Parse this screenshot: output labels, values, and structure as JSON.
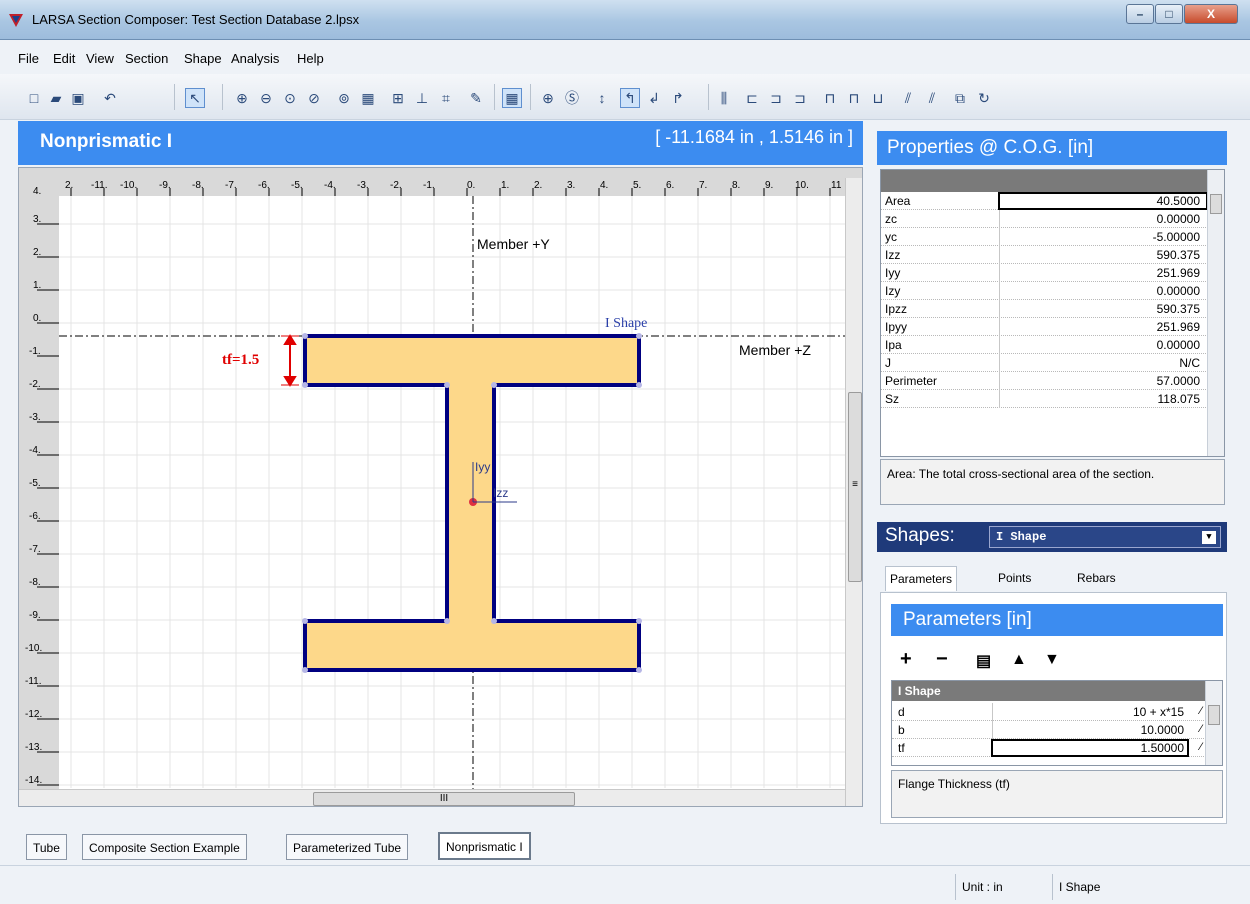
{
  "window": {
    "title": "LARSA Section Composer: Test Section Database 2.lpsx",
    "controls": [
      "–",
      "□",
      "X"
    ]
  },
  "menu": [
    "File",
    "Edit",
    "View",
    "Section",
    "Shape",
    "Analysis",
    "Help"
  ],
  "canvas": {
    "title": "Nonprismatic I",
    "cursor_coord": "[ -11.1684 in , 1.5146 in ]",
    "ruler_x": [
      "2.",
      "-11.",
      "-10.",
      "-9.",
      "-8.",
      "-7.",
      "-6.",
      "-5.",
      "-4.",
      "-3.",
      "-2.",
      "-1.",
      "0.",
      "1.",
      "2.",
      "3.",
      "4.",
      "5.",
      "6.",
      "7.",
      "8.",
      "9.",
      "10.",
      "11"
    ],
    "ruler_y": [
      "4.",
      "3.",
      "2.",
      "1.",
      "0.",
      "-1.",
      "-2.",
      "-3.",
      "-4.",
      "-5.",
      "-6.",
      "-7.",
      "-8.",
      "-9.",
      "-10.",
      "-11.",
      "-12.",
      "-13.",
      "-14."
    ],
    "axis_y_label": "Member +Y",
    "axis_z_label": "Member +Z",
    "shape_label": "I Shape",
    "dim_label": "tf=1.5",
    "iyy_label": "Iyy",
    "izz_label": "Izz",
    "hscroll_mark": "III",
    "vscroll_mark": "≡"
  },
  "properties": {
    "title": "Properties @ C.O.G. [in]",
    "rows": [
      {
        "name": "Area",
        "value": "40.5000"
      },
      {
        "name": "zc",
        "value": "0.00000"
      },
      {
        "name": "yc",
        "value": "-5.00000"
      },
      {
        "name": "Izz",
        "value": "590.375"
      },
      {
        "name": "Iyy",
        "value": "251.969"
      },
      {
        "name": "Izy",
        "value": "0.00000"
      },
      {
        "name": "Ipzz",
        "value": "590.375"
      },
      {
        "name": "Ipyy",
        "value": "251.969"
      },
      {
        "name": "Ipa",
        "value": "0.00000"
      },
      {
        "name": "J",
        "value": "N/C"
      },
      {
        "name": "Perimeter",
        "value": "57.0000"
      },
      {
        "name": "Sz",
        "value": "118.075"
      }
    ],
    "description": "Area: The total cross-sectional area of the section."
  },
  "shapes": {
    "label": "Shapes:",
    "selected": "I Shape"
  },
  "right_tabs": [
    "Parameters",
    "Points",
    "Rebars"
  ],
  "parameters": {
    "title": "Parameters [in]",
    "table_title": "I Shape",
    "rows": [
      {
        "name": "d",
        "value": "10 + x*15"
      },
      {
        "name": "b",
        "value": "10.0000"
      },
      {
        "name": "tf",
        "value": "1.50000"
      }
    ],
    "description": "Flange Thickness (tf)"
  },
  "doc_tabs": [
    "Tube",
    "Composite Section Example",
    "Parameterized Tube",
    "Nonprismatic I"
  ],
  "status": {
    "unit": "Unit : in",
    "shape": "I Shape"
  },
  "colors": {
    "accent_blue": "#3c8cf0",
    "shape_fill": "#fdd88a",
    "shape_outline": "#000080",
    "dim_red": "#e00000"
  }
}
